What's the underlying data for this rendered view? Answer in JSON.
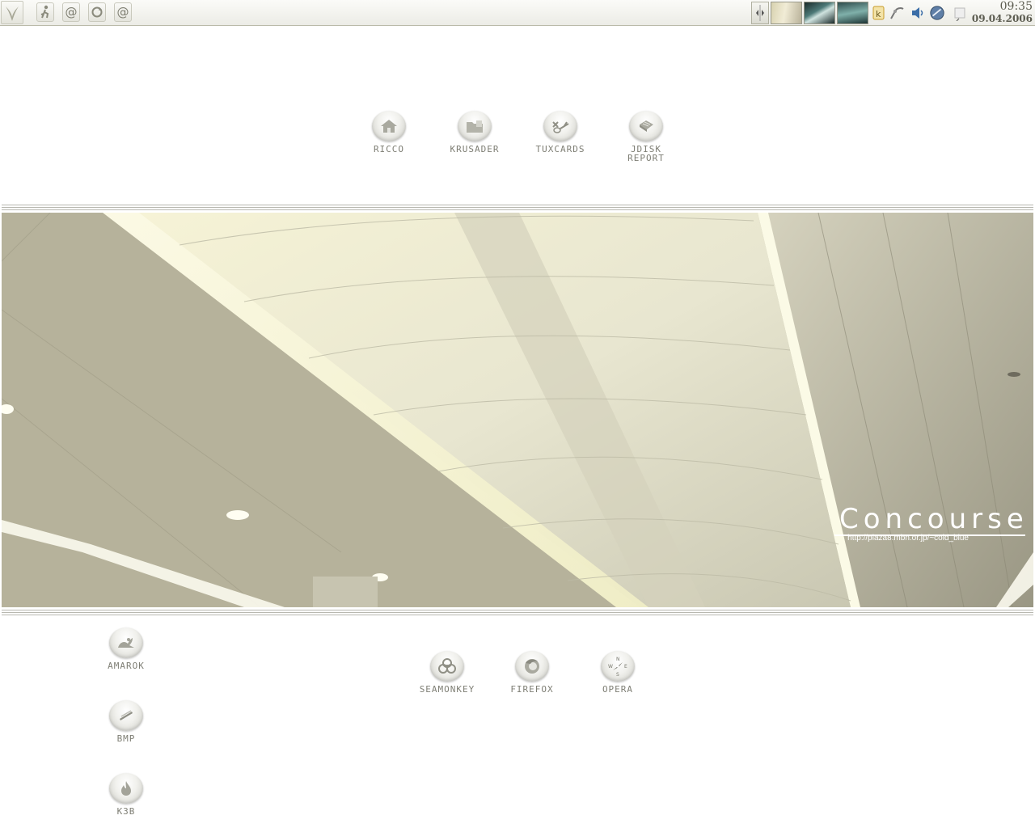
{
  "panel": {
    "kmenu_icon": "k-menu-icon",
    "quicklaunch": [
      {
        "name": "run-icon"
      },
      {
        "name": "at-icon",
        "glyph": "@"
      },
      {
        "name": "refresh-icon"
      },
      {
        "name": "at-icon",
        "glyph": "@"
      }
    ],
    "clock": {
      "time": "09:35",
      "date": "09.04.2006"
    }
  },
  "desktop_top_icons": [
    {
      "label": "RICCO",
      "icon": "home-icon"
    },
    {
      "label": "KRUSADER",
      "icon": "folder-icon"
    },
    {
      "label": "TUXCARDS",
      "icon": "tools-icon"
    },
    {
      "label": "JDISK\nREPORT",
      "icon": "disk-report-icon"
    }
  ],
  "desktop_left_icons": [
    {
      "label": "AMAROK",
      "icon": "amarok-icon"
    },
    {
      "label": "BMP",
      "icon": "bmp-icon"
    },
    {
      "label": "K3B",
      "icon": "flame-icon"
    }
  ],
  "desktop_browser_icons": [
    {
      "label": "SEAMONKEY",
      "icon": "biohazard-icon"
    },
    {
      "label": "FIREFOX",
      "icon": "firefox-icon"
    },
    {
      "label": "OPERA",
      "icon": "compass-icon"
    }
  ],
  "wallpaper": {
    "title": "Concourse",
    "url": "http://plaza8.mbn.or.jp/~cold_blue"
  },
  "colors": {
    "panel_bg": "#f2f2ec",
    "label_text": "#7e7e74",
    "photo_base": "#b7b29a"
  }
}
